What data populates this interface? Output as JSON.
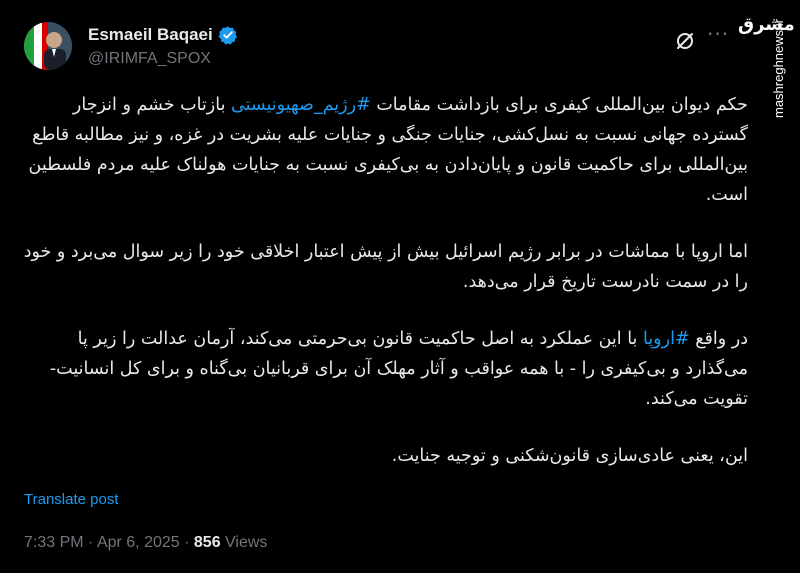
{
  "author": {
    "name": "Esmaeil Baqaei",
    "handle": "@IRIMFA_SPOX"
  },
  "icons": {
    "verified": "verified-badge-icon",
    "grok": "grok-icon",
    "more": "more-options-icon"
  },
  "watermark": {
    "logo_text": "مشرق",
    "site": "mashreghnews.ir"
  },
  "tweet": {
    "p1_before": "حکم دیوان بین‌المللی کیفری برای بازداشت مقامات ",
    "p1_hashtag": "#رژیم_صهیونیستی",
    "p1_after": " بازتاب خشم و انزجار گسترده جهانی نسبت به نسل‌کشی، جنایات جنگی و جنایات علیه بشریت در غزه، و نیز مطالبه قاطع بین‌المللی برای حاکمیت قانون و پایان‌دادن به بی‌کیفری نسبت به جنایات هولناک علیه مردم فلسطین است.",
    "p2": "اما اروپا با مماشات در برابر رژیم اسرائیل بیش از پیش اعتبار اخلاقی خود را زیر سوال می‌برد و خود را در سمت نادرست تاریخ قرار می‌دهد.",
    "p3_before": "در واقع ",
    "p3_hashtag": "#اروپا",
    "p3_after": " با این عملکرد به اصل حاکمیت قانون بی‌حرمتی می‌کند، آرمان عدالت را زیر پا می‌گذارد و بی‌کیفری را - با همه عواقب و آثار مهلک آن برای قربانیان بی‌گناه و برای کل انسانیت- تقویت می‌کند.",
    "p4": "این، یعنی عادی‌سازی قانون‌شکنی و توجیه جنایت."
  },
  "translate_label": "Translate post",
  "meta": {
    "time": "7:33 PM",
    "sep": " · ",
    "date": "Apr 6, 2025",
    "views_count": "856",
    "views_label": " Views"
  },
  "colors": {
    "background": "#000000",
    "text": "#e7e9ea",
    "muted": "#71767b",
    "accent": "#1d9bf0"
  }
}
